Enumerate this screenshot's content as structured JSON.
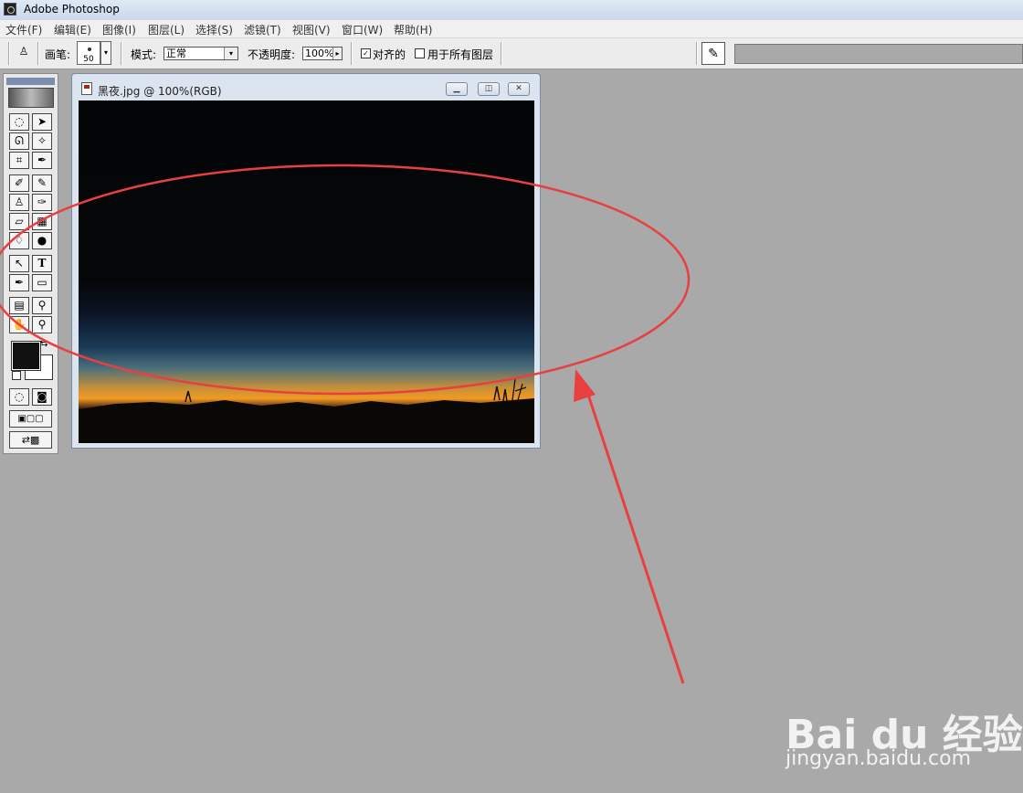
{
  "window": {
    "title": "Adobe Photoshop"
  },
  "menu": [
    "文件(F)",
    "编辑(E)",
    "图像(I)",
    "图层(L)",
    "选择(S)",
    "滤镜(T)",
    "视图(V)",
    "窗口(W)",
    "帮助(H)"
  ],
  "options": {
    "brush_label": "画笔:",
    "brush_size": "50",
    "mode_label": "模式:",
    "mode_value": "正常",
    "opacity_label": "不透明度:",
    "opacity_value": "100%",
    "aligned_label": "对齐的",
    "aligned_checked": "✓",
    "all_layers_label": "用于所有图层"
  },
  "document": {
    "title": "黑夜.jpg @ 100%(RGB)"
  },
  "toolbox": {
    "tools": [
      "marquee-icon",
      "move-icon",
      "lasso-icon",
      "magic-wand-icon",
      "crop-icon",
      "slice-icon",
      "healing-icon",
      "brush-icon",
      "clone-stamp-icon",
      "history-brush-icon",
      "eraser-icon",
      "gradient-icon",
      "blur-icon",
      "dodge-icon",
      "path-select-icon",
      "text-icon",
      "pen-icon",
      "shape-icon",
      "notes-icon",
      "eyedropper-icon",
      "hand-icon",
      "zoom-icon"
    ]
  },
  "watermark": {
    "brand": "Bai du 经验",
    "url": "jingyan.baidu.com"
  },
  "annotation_colors": {
    "ellipse": "#e84040",
    "arrow": "#e84040"
  }
}
